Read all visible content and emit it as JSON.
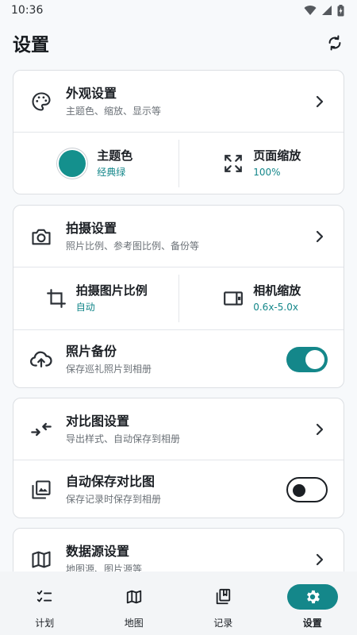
{
  "status_bar": {
    "time": "10:36"
  },
  "header": {
    "title": "设置"
  },
  "appearance": {
    "title": "外观设置",
    "subtitle": "主题色、缩放、显示等",
    "theme_color_label": "主题色",
    "theme_color_value": "经典绿",
    "page_zoom_label": "页面缩放",
    "page_zoom_value": "100%",
    "theme_color_hex": "#14908d"
  },
  "capture": {
    "title": "拍摄设置",
    "subtitle": "照片比例、参考图比例、备份等",
    "ratio_label": "拍摄图片比例",
    "ratio_value": "自动",
    "camera_zoom_label": "相机缩放",
    "camera_zoom_value": "0.6x-5.0x",
    "backup_title": "照片备份",
    "backup_subtitle": "保存巡礼照片到相册",
    "backup_enabled": true
  },
  "compare": {
    "title": "对比图设置",
    "subtitle": "导出样式、自动保存到相册",
    "autosave_title": "自动保存对比图",
    "autosave_subtitle": "保存记录时保存到相册",
    "autosave_enabled": false
  },
  "datasource": {
    "title": "数据源设置",
    "subtitle": "地图源、图片源等"
  },
  "bottom_nav": {
    "items": [
      {
        "label": "计划",
        "icon": "checklist-icon"
      },
      {
        "label": "地图",
        "icon": "map-icon"
      },
      {
        "label": "记录",
        "icon": "bookmark-stack-icon"
      },
      {
        "label": "设置",
        "icon": "gear-icon",
        "active": true
      }
    ]
  },
  "colors": {
    "accent": "#14878a",
    "card_border": "#dcdfe3",
    "background": "#f7f9fb"
  }
}
